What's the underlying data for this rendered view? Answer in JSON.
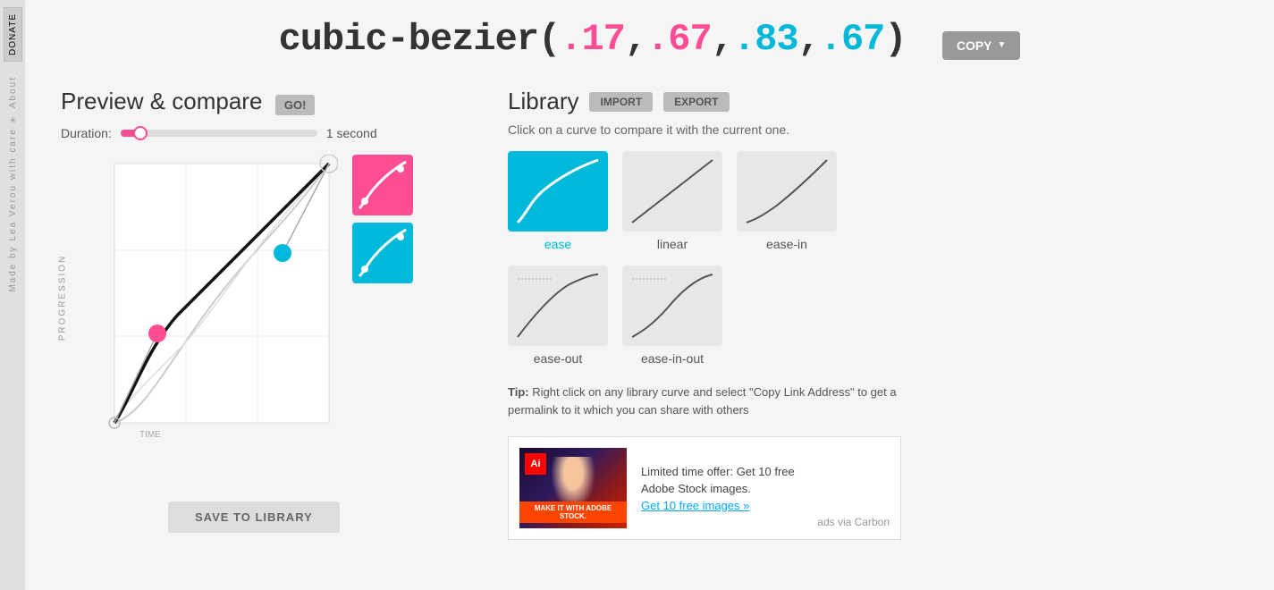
{
  "sidebar": {
    "donate_label": "DONATE",
    "tagline": "Made by Lea Verou with care ✳ About"
  },
  "header": {
    "formula_prefix": "cubic-bezier(",
    "p1": ".17",
    "comma1": ",",
    "p2": ".67",
    "comma2": ",",
    "p3": ".83",
    "comma3": ",",
    "p4": ".67",
    "formula_suffix": ")",
    "copy_label": "COPY"
  },
  "preview": {
    "title": "Preview & compare",
    "go_label": "GO!",
    "duration_label": "Duration:",
    "duration_value": "1 second"
  },
  "library": {
    "title": "Library",
    "import_label": "IMPORT",
    "export_label": "EXPORT",
    "description": "Click on a curve to compare it with the current one.",
    "items": [
      {
        "name": "ease",
        "active": true
      },
      {
        "name": "linear",
        "active": false
      },
      {
        "name": "ease-in",
        "active": false
      },
      {
        "name": "ease-out",
        "active": false
      },
      {
        "name": "ease-in-out",
        "active": false
      }
    ],
    "tip": "Tip: Right click on any library curve and select \"Copy Link Address\" to get a permalink to it which you can share with others"
  },
  "ad": {
    "text": "Limited time offer: Get 10 free Adobe Stock images.",
    "cta": "Get 10 free images »",
    "via": "ads via Carbon"
  },
  "save_button": "SAVE TO LIBRARY",
  "axis": {
    "y_label": "PROGRESSION",
    "x_label": "TIME"
  }
}
